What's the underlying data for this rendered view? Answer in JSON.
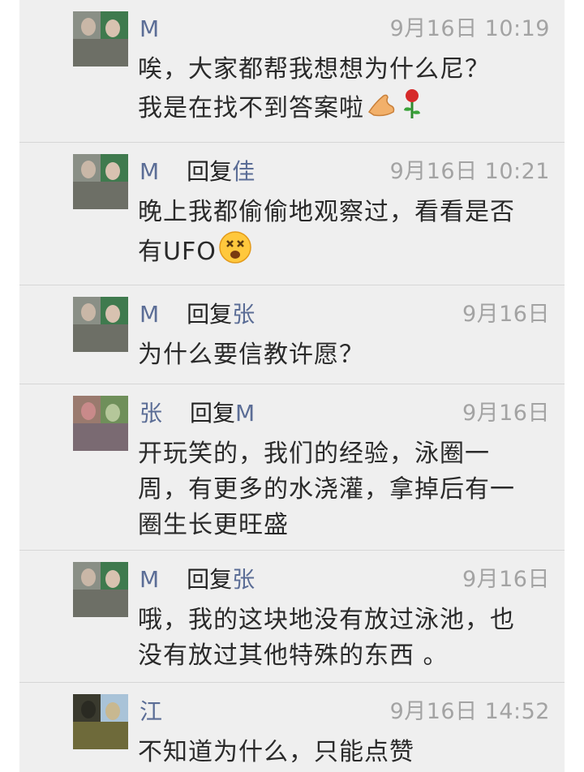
{
  "comments": [
    {
      "name": "M",
      "reply_word": "",
      "reply_to": "",
      "time": "9月16日 10:19",
      "lines": [
        "唉，大家都帮我想想为什么尼？",
        "我是在找不到答案啦"
      ],
      "emojis": [
        "praying-hands",
        "rose"
      ]
    },
    {
      "name": "M",
      "reply_word": "回复",
      "reply_to": "佳",
      "time": "9月16日 10:21",
      "lines": [
        "晚上我都偷偷地观察过，看看是否",
        "有UFO"
      ],
      "emojis": [
        "dizzy-face"
      ]
    },
    {
      "name": "M",
      "reply_word": "回复",
      "reply_to": "张",
      "time": "9月16日",
      "lines": [
        "为什么要信教许愿？"
      ],
      "emojis": []
    },
    {
      "name": "张",
      "reply_word": "回复",
      "reply_to": "M",
      "time": "9月16日",
      "lines": [
        "开玩笑的，我们的经验，泳圈一",
        "周，有更多的水浇灌，拿掉后有一",
        "圈生长更旺盛"
      ],
      "emojis": []
    },
    {
      "name": "M",
      "reply_word": "回复",
      "reply_to": "张",
      "time": "9月16日",
      "lines": [
        "哦，我的这块地没有放过泳池，也",
        "没有放过其他特殊的东西 。"
      ],
      "emojis": []
    },
    {
      "name": "江",
      "reply_word": "",
      "reply_to": "",
      "time": "9月16日 14:52",
      "lines": [
        "不知道为什么，只能点赞"
      ],
      "emojis": []
    }
  ],
  "colors": {
    "name": "#5b6d96",
    "time": "#a3a3a3",
    "text": "#2a2a2a",
    "background": "#efefef"
  }
}
